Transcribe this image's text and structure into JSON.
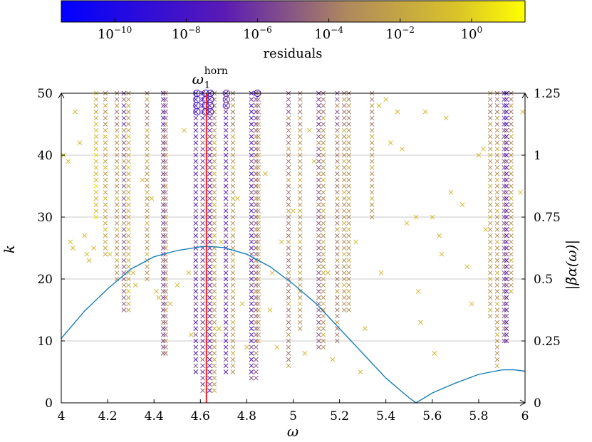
{
  "chart_data": {
    "type": "scatter",
    "title": "",
    "xlabel": "ω",
    "ylabel_left": "k",
    "ylabel_right": "|β̃α(ω)|",
    "xlim": [
      4,
      6
    ],
    "ylim_left": [
      0,
      50
    ],
    "ylim_right": [
      0,
      1.25
    ],
    "grid": "horizontal",
    "x_ticks": [
      "4",
      "4.2",
      "4.4",
      "4.6",
      "4.8",
      "5",
      "5.2",
      "5.4",
      "5.6",
      "5.8",
      "6"
    ],
    "y_left_ticks": [
      "0",
      "10",
      "20",
      "30",
      "40",
      "50"
    ],
    "y_right_ticks": [
      "0",
      "0.25",
      "0.5",
      "0.75",
      "1",
      "1.25"
    ],
    "colorbar": {
      "label": "residuals",
      "scale": "log",
      "range_exponent": [
        -11.5,
        1.5
      ],
      "ticks": [
        {
          "base": "10",
          "exp": "−10",
          "value": -10
        },
        {
          "base": "10",
          "exp": "−8",
          "value": -8
        },
        {
          "base": "10",
          "exp": "−6",
          "value": -6
        },
        {
          "base": "10",
          "exp": "−4",
          "value": -4
        },
        {
          "base": "10",
          "exp": "−2",
          "value": -2
        },
        {
          "base": "10",
          "exp": "0",
          "value": 0
        }
      ],
      "colors": [
        "#0000ff",
        "#5a1ab4",
        "#b08a5c",
        "#d9c22a",
        "#ffff00"
      ]
    },
    "annotation": {
      "base": "ω",
      "sub": "1",
      "sup": "horn",
      "x": 4.626
    },
    "vertical_line": {
      "x": 4.626,
      "color": "#e8231e"
    },
    "curve": {
      "name": "|β̃α(ω)|",
      "color": "#1a7fb5",
      "x": [
        4.0,
        4.1,
        4.2,
        4.3,
        4.4,
        4.5,
        4.6,
        4.63,
        4.7,
        4.8,
        4.9,
        5.0,
        5.1,
        5.2,
        5.3,
        5.4,
        5.5,
        5.53,
        5.6,
        5.7,
        5.8,
        5.9,
        5.95,
        6.0
      ],
      "y": [
        0.26,
        0.37,
        0.46,
        0.54,
        0.59,
        0.615,
        0.63,
        0.632,
        0.627,
        0.6,
        0.55,
        0.48,
        0.4,
        0.3,
        0.2,
        0.1,
        0.02,
        0.0,
        0.04,
        0.08,
        0.115,
        0.133,
        0.134,
        0.128
      ]
    },
    "columns": [
      {
        "x": 4.15,
        "k": [
          30,
          50
        ],
        "step": 1,
        "res": -1
      },
      {
        "x": 4.19,
        "k": [
          24,
          50
        ],
        "step": 1,
        "res": -2
      },
      {
        "x": 4.24,
        "k": [
          20,
          50
        ],
        "step": 1,
        "res": -3
      },
      {
        "x": 4.27,
        "k": [
          15,
          50
        ],
        "step": 1,
        "res": -5
      },
      {
        "x": 4.29,
        "k": [
          15,
          50
        ],
        "step": 1,
        "res": -2
      },
      {
        "x": 4.37,
        "k": [
          20,
          50
        ],
        "step": 1,
        "res": -3
      },
      {
        "x": 4.44,
        "k": [
          8,
          50
        ],
        "step": 1,
        "res": -6
      },
      {
        "x": 4.45,
        "k": [
          8,
          50
        ],
        "step": 1,
        "res": -4
      },
      {
        "x": 4.58,
        "k": [
          5,
          50
        ],
        "step": 1,
        "res": -7
      },
      {
        "x": 4.61,
        "k": [
          2,
          50
        ],
        "step": 1,
        "res": -6
      },
      {
        "x": 4.64,
        "k": [
          2,
          50
        ],
        "step": 1,
        "res": -7
      },
      {
        "x": 4.66,
        "k": [
          2,
          50
        ],
        "step": 1,
        "res": -3
      },
      {
        "x": 4.71,
        "k": [
          5,
          50
        ],
        "step": 1,
        "res": -7
      },
      {
        "x": 4.74,
        "k": [
          5,
          50
        ],
        "step": 1,
        "res": -3
      },
      {
        "x": 4.82,
        "k": [
          4,
          50
        ],
        "step": 1,
        "res": -7
      },
      {
        "x": 4.84,
        "k": [
          4,
          50
        ],
        "step": 1,
        "res": -5
      },
      {
        "x": 4.85,
        "k": [
          10,
          50
        ],
        "step": 1,
        "res": -3
      },
      {
        "x": 4.98,
        "k": [
          6,
          50
        ],
        "step": 1,
        "res": -4
      },
      {
        "x": 5.03,
        "k": [
          12,
          50
        ],
        "step": 1,
        "res": -3
      },
      {
        "x": 5.11,
        "k": [
          9,
          50
        ],
        "step": 1,
        "res": -5
      },
      {
        "x": 5.13,
        "k": [
          9,
          50
        ],
        "step": 1,
        "res": -3
      },
      {
        "x": 5.19,
        "k": [
          10,
          50
        ],
        "step": 1,
        "res": -4
      },
      {
        "x": 5.22,
        "k": [
          15,
          50
        ],
        "step": 1,
        "res": -3
      },
      {
        "x": 5.24,
        "k": [
          15,
          50
        ],
        "step": 1,
        "res": -3
      },
      {
        "x": 5.34,
        "k": [
          30,
          50
        ],
        "step": 1,
        "res": -3
      },
      {
        "x": 5.85,
        "k": [
          14,
          50
        ],
        "step": 1,
        "res": -3
      },
      {
        "x": 5.88,
        "k": [
          6,
          50
        ],
        "step": 1,
        "res": -3
      },
      {
        "x": 5.91,
        "k": [
          10,
          50
        ],
        "step": 1,
        "res": -5
      },
      {
        "x": 5.92,
        "k": [
          10,
          50
        ],
        "step": 1,
        "res": -7
      },
      {
        "x": 5.94,
        "k": [
          18,
          50
        ],
        "step": 1,
        "res": -3
      }
    ],
    "scatter_points": [
      {
        "x": 4.01,
        "k": 40,
        "res": -1
      },
      {
        "x": 4.03,
        "k": 39,
        "res": -1
      },
      {
        "x": 4.04,
        "k": 26,
        "res": -1
      },
      {
        "x": 4.05,
        "k": 25,
        "res": -1
      },
      {
        "x": 4.06,
        "k": 47,
        "res": -1
      },
      {
        "x": 4.08,
        "k": 42,
        "res": -1
      },
      {
        "x": 4.1,
        "k": 27,
        "res": -1
      },
      {
        "x": 4.11,
        "k": 24,
        "res": -1
      },
      {
        "x": 4.12,
        "k": 23,
        "res": -1
      },
      {
        "x": 4.14,
        "k": 25,
        "res": -1
      },
      {
        "x": 4.21,
        "k": 24,
        "res": -1
      },
      {
        "x": 4.31,
        "k": 21,
        "res": -1
      },
      {
        "x": 4.32,
        "k": 19,
        "res": -1
      },
      {
        "x": 4.35,
        "k": 36,
        "res": -1
      },
      {
        "x": 4.39,
        "k": 33,
        "res": -1
      },
      {
        "x": 4.41,
        "k": 18,
        "res": -1
      },
      {
        "x": 4.42,
        "k": 17,
        "res": -1
      },
      {
        "x": 4.47,
        "k": 16,
        "res": -1
      },
      {
        "x": 4.5,
        "k": 19,
        "res": -1
      },
      {
        "x": 4.53,
        "k": 44,
        "res": -1
      },
      {
        "x": 4.55,
        "k": 21,
        "res": -1
      },
      {
        "x": 4.56,
        "k": 11,
        "res": -1
      },
      {
        "x": 4.68,
        "k": 12,
        "res": -1
      },
      {
        "x": 4.69,
        "k": 26,
        "res": -1
      },
      {
        "x": 4.76,
        "k": 33,
        "res": -1
      },
      {
        "x": 4.78,
        "k": 16,
        "res": -1
      },
      {
        "x": 4.8,
        "k": 9,
        "res": -1
      },
      {
        "x": 4.88,
        "k": 37,
        "res": -1
      },
      {
        "x": 4.9,
        "k": 15,
        "res": -1
      },
      {
        "x": 4.91,
        "k": 21,
        "res": -1
      },
      {
        "x": 4.93,
        "k": 9,
        "res": -1
      },
      {
        "x": 4.95,
        "k": 26,
        "res": -1
      },
      {
        "x": 5.0,
        "k": 31,
        "res": -1
      },
      {
        "x": 5.05,
        "k": 8,
        "res": -1
      },
      {
        "x": 5.07,
        "k": 44,
        "res": -1
      },
      {
        "x": 5.09,
        "k": 39,
        "res": -1
      },
      {
        "x": 5.15,
        "k": 21,
        "res": -1
      },
      {
        "x": 5.17,
        "k": 7,
        "res": -1
      },
      {
        "x": 5.27,
        "k": 26,
        "res": -1
      },
      {
        "x": 5.29,
        "k": 5,
        "res": -1
      },
      {
        "x": 5.31,
        "k": 12,
        "res": -1
      },
      {
        "x": 5.37,
        "k": 48,
        "res": -1
      },
      {
        "x": 5.38,
        "k": 21,
        "res": -1
      },
      {
        "x": 5.4,
        "k": 49,
        "res": -1
      },
      {
        "x": 5.42,
        "k": 42,
        "res": -1
      },
      {
        "x": 5.45,
        "k": 47,
        "res": -1
      },
      {
        "x": 5.47,
        "k": 41,
        "res": -1
      },
      {
        "x": 5.49,
        "k": 29,
        "res": -1
      },
      {
        "x": 5.53,
        "k": 30,
        "res": -1
      },
      {
        "x": 5.54,
        "k": 18,
        "res": -1
      },
      {
        "x": 5.55,
        "k": 13,
        "res": -1
      },
      {
        "x": 5.57,
        "k": 47,
        "res": -1
      },
      {
        "x": 5.6,
        "k": 30,
        "res": -1
      },
      {
        "x": 5.61,
        "k": 8,
        "res": -1
      },
      {
        "x": 5.63,
        "k": 27,
        "res": -1
      },
      {
        "x": 5.64,
        "k": 24,
        "res": -1
      },
      {
        "x": 5.66,
        "k": 46,
        "res": -1
      },
      {
        "x": 5.68,
        "k": 34,
        "res": -1
      },
      {
        "x": 5.73,
        "k": 32,
        "res": -1
      },
      {
        "x": 5.75,
        "k": 22,
        "res": -1
      },
      {
        "x": 5.77,
        "k": 16,
        "res": -1
      },
      {
        "x": 5.8,
        "k": 40,
        "res": -1
      },
      {
        "x": 5.82,
        "k": 41,
        "res": -1
      },
      {
        "x": 5.83,
        "k": 28,
        "res": -1
      },
      {
        "x": 5.98,
        "k": 34,
        "res": -1
      },
      {
        "x": 5.99,
        "k": 47,
        "res": -1
      }
    ],
    "circles": [
      {
        "x": 4.585,
        "k": [
          50,
          49,
          48,
          47
        ],
        "res": -8
      },
      {
        "x": 4.622,
        "k": [
          50,
          49,
          48,
          47
        ],
        "res": -8
      },
      {
        "x": 4.643,
        "k": [
          50,
          49,
          48,
          47
        ],
        "res": -8
      },
      {
        "x": 4.712,
        "k": [
          50,
          49,
          48
        ],
        "res": -6
      },
      {
        "x": 4.846,
        "k": [
          50
        ],
        "res": -8
      }
    ]
  }
}
